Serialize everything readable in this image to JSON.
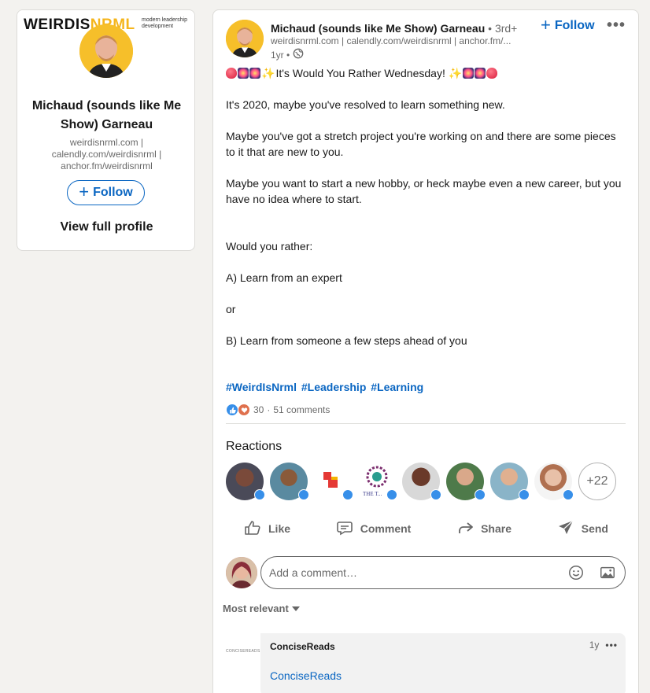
{
  "profile_card": {
    "banner_logo_text": "WEIRDIS",
    "banner_logo_accent": "NRML",
    "banner_tagline": "modern leadership development",
    "name": "Michaud (sounds like Me Show) Garneau",
    "headline": "weirdisnrml.com | calendly.com/weirdisnrml | anchor.fm/weirdisnrml",
    "follow_label": "Follow",
    "view_profile_label": "View full profile"
  },
  "post": {
    "author_name": "Michaud (sounds like Me Show) Garneau",
    "author_degree": " • 3rd+",
    "author_headline": "weirdisnrml.com | calendly.com/weirdisnrml | anchor.fm/...",
    "time": "1yr •",
    "follow_label": "Follow",
    "more_label": "•••",
    "text_line1": "It's Would You Rather Wednesday!",
    "text_line2": "It's 2020, maybe you've resolved to learn something new.",
    "text_line3": "Maybe you've got a stretch project you're working on and there are some pieces to it that are new to you.",
    "text_line4": "Maybe you want to start a new hobby, or heck maybe even a new career, but you have no idea where to start.",
    "text_line5": "Would you rather:",
    "text_line6": "A) Learn from an expert",
    "text_line7": "or",
    "text_line8": "B) Learn from someone a few steps ahead of you",
    "hashtags": [
      "#WeirdIsNrml",
      "#Leadership",
      "#Learning"
    ],
    "reaction_count": "30",
    "comment_count": "51 comments",
    "separator": "·"
  },
  "reactions": {
    "title": "Reactions",
    "more_count": "+22"
  },
  "actions": {
    "like": "Like",
    "comment": "Comment",
    "share": "Share",
    "send": "Send"
  },
  "comment_input": {
    "placeholder": "Add a comment…"
  },
  "sort": {
    "label": "Most relevant"
  },
  "first_comment": {
    "logo_text": "CONCISEREADS",
    "author": "ConciseReads",
    "time": "1y",
    "dots": "•••",
    "body": "ConciseReads"
  },
  "colors": {
    "accent_blue": "#0a66c2",
    "brand_yellow": "#f6bf2a",
    "background": "#f3f2ef"
  }
}
